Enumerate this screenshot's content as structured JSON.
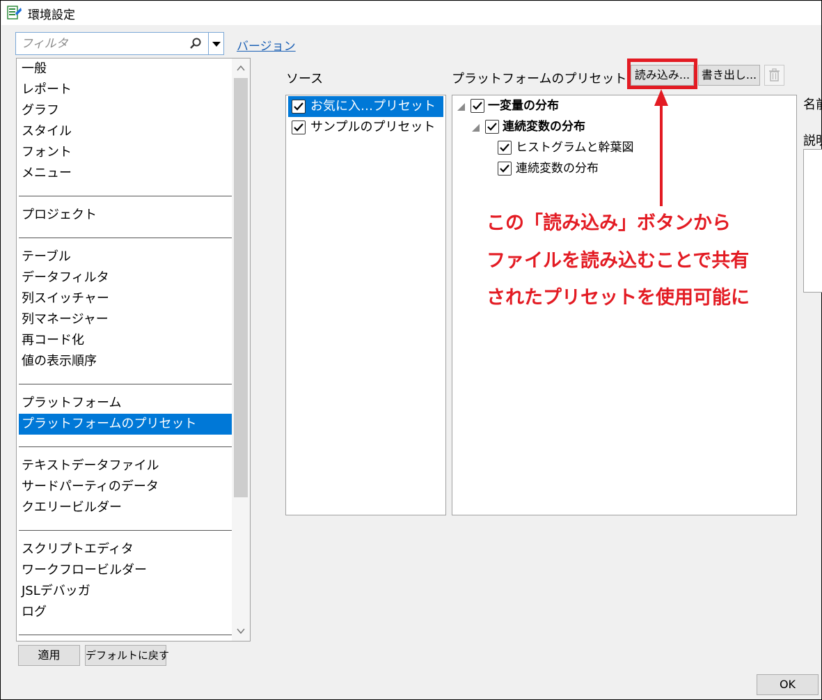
{
  "window": {
    "title": "環境設定"
  },
  "filter": {
    "placeholder": "フィルタ",
    "value": ""
  },
  "version_link": "バージョン",
  "sidebar": {
    "items": [
      "一般",
      "レポート",
      "グラフ",
      "スタイル",
      "フォント",
      "メニュー",
      "プロジェクト",
      "テーブル",
      "データフィルタ",
      "列スイッチャー",
      "列マネージャー",
      "再コード化",
      "値の表示順序",
      "プラットフォーム",
      "プラットフォームのプリセット",
      "テキストデータファイル",
      "サードパーティのデータ",
      "クエリービルダー",
      "スクリプトエディタ",
      "ワークフロービルダー",
      "JSLデバッガ",
      "ログ"
    ],
    "selected": "プラットフォームのプリセット"
  },
  "buttons": {
    "apply": "適用",
    "reset_default": "デフォルトに戻す",
    "import": "読み込み...",
    "export": "書き出し...",
    "ok": "OK"
  },
  "source": {
    "label": "ソース",
    "items": [
      {
        "label": "お気に入…プリセット",
        "checked": true,
        "selected": true
      },
      {
        "label": "サンプルのプリセット",
        "checked": true,
        "selected": false
      }
    ]
  },
  "presets": {
    "label": "プラットフォームのプリセット",
    "tree": [
      {
        "label": "一変量の分布",
        "checked": true,
        "level": 0,
        "bold": true,
        "expanded": true
      },
      {
        "label": "連続変数の分布",
        "checked": true,
        "level": 1,
        "bold": true,
        "expanded": true
      },
      {
        "label": "ヒストグラムと幹葉図",
        "checked": true,
        "level": 2,
        "bold": false
      },
      {
        "label": "連続変数の分布",
        "checked": true,
        "level": 2,
        "bold": false
      }
    ]
  },
  "right_panel": {
    "name_label": "名前",
    "description_label": "説明"
  },
  "annotation": {
    "lines": [
      "この「読み込み」ボタンから",
      "ファイルを読み込むことで共有",
      "されたプリセットを使用可能に"
    ],
    "color": "#e31b23"
  },
  "colors": {
    "selection": "#0078d7",
    "link": "#1a5fb4"
  }
}
